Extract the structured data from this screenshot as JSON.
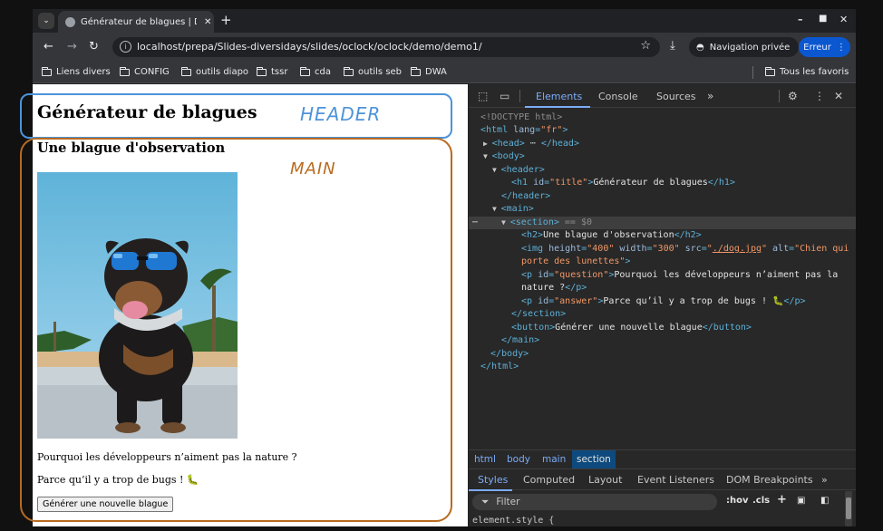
{
  "tab": {
    "title": "Générateur de blagues | DC",
    "close": "✕"
  },
  "browser": {
    "url": "localhost/prepa/Slides-diversidays/slides/oclock/oclock/demo/demo1/",
    "private_label": "Navigation privée",
    "error_label": "Erreur"
  },
  "bookmarks": [
    "Liens divers",
    "CONFIG",
    "outils diapo",
    "tssr",
    "cda",
    "outils seb",
    "DWA"
  ],
  "all_bookmarks": "Tous les favoris",
  "page": {
    "h1": "Générateur de blagues",
    "h2": "Une blague d'observation",
    "question": "Pourquoi les développeurs n’aiment pas la nature ?",
    "answer": "Parce qu’il y a trop de bugs ! 🐛",
    "button": "Générer une nouvelle blague"
  },
  "annotations": {
    "header": "HEADER",
    "main": "MAIN"
  },
  "devtools": {
    "tabs": [
      "Elements",
      "Console",
      "Sources"
    ],
    "crumbs": [
      "html",
      "body",
      "main",
      "section"
    ],
    "styles_tabs": [
      "Styles",
      "Computed",
      "Layout",
      "Event Listeners",
      "DOM Breakpoints"
    ],
    "filter_placeholder": "Filter",
    "hov": ":hov",
    "cls": ".cls",
    "element_style": "element.style {"
  },
  "colors": {
    "header_annotation": "#4d93d9",
    "main_annotation": "#b86b1f",
    "devtools_accent": "#7cacf8",
    "error_button": "#0b57d0"
  }
}
